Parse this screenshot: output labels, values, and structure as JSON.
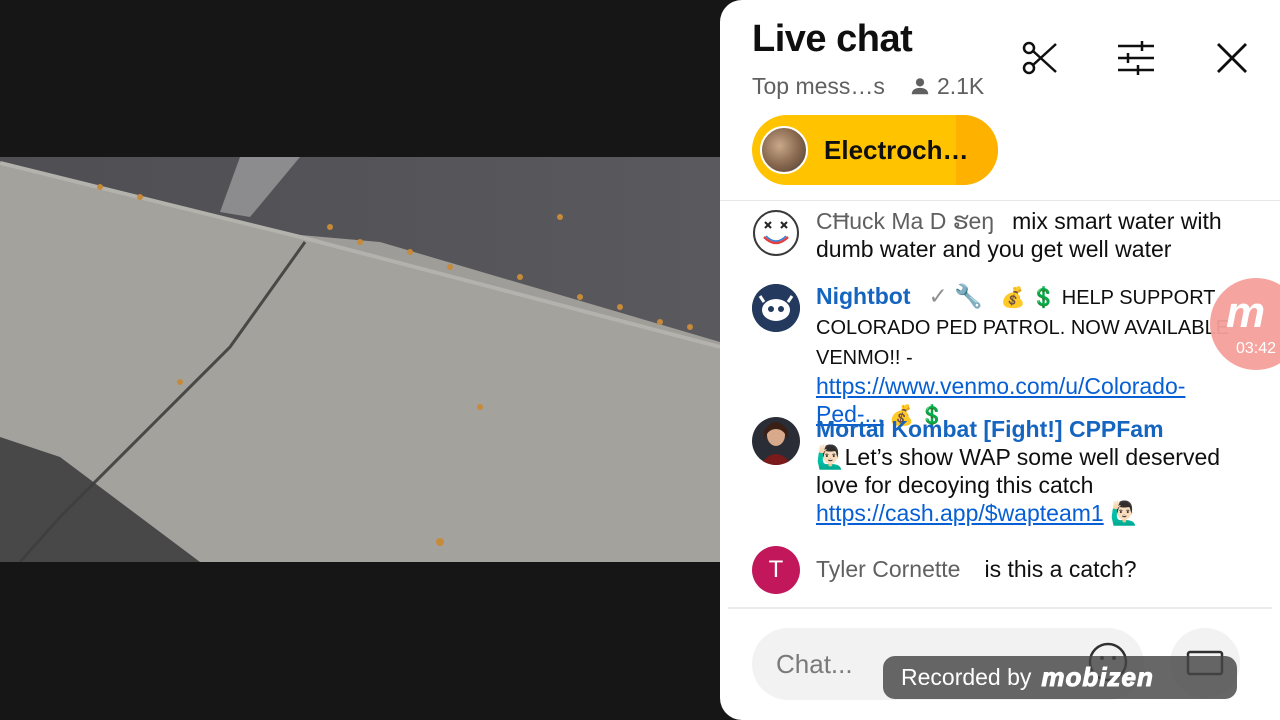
{
  "video": {
    "description_icon": "sidewalk-video-frame"
  },
  "chat": {
    "title": "Live chat",
    "mode": "Top mess…s",
    "viewers": "2.1K",
    "pinned_label": "Electroch…",
    "messages": [
      {
        "author": "CĦuck Ma D ຮeŋ",
        "text": "mix smart water with dumb water and you get well water"
      },
      {
        "author": "Nightbot",
        "badges": "✓ 🔧",
        "text_1": "💰 💲 HELP SUPPORT COLORADO PED PATROL. NOW AVAILABLE VENMO!! - ",
        "link": "https://www.venmo.com/u/Colorado-Ped-...",
        "text_2": " 💰 💲"
      },
      {
        "author": "Mortal Kombat [Fight!] CPPFam",
        "text_1": "🙋🏻‍♂️Let’s show WAP some well deserved love for decoying this catch ",
        "link": "https://cash.app/$wapteam1",
        "text_2": " 🙋🏻‍♂️"
      },
      {
        "author": "Tyler Cornette",
        "avatar_letter": "T",
        "text": "is this a catch?"
      }
    ],
    "input_placeholder": "Chat..."
  },
  "timer": {
    "logo": "m",
    "time": "03:42"
  },
  "watermark": {
    "label": "Recorded by",
    "brand": "mobizen"
  },
  "colors": {
    "pinned_bg": "#ffc300",
    "link": "#065fd4",
    "author_blue": "#1565c0",
    "tyler_avatar": "#c2185b"
  }
}
